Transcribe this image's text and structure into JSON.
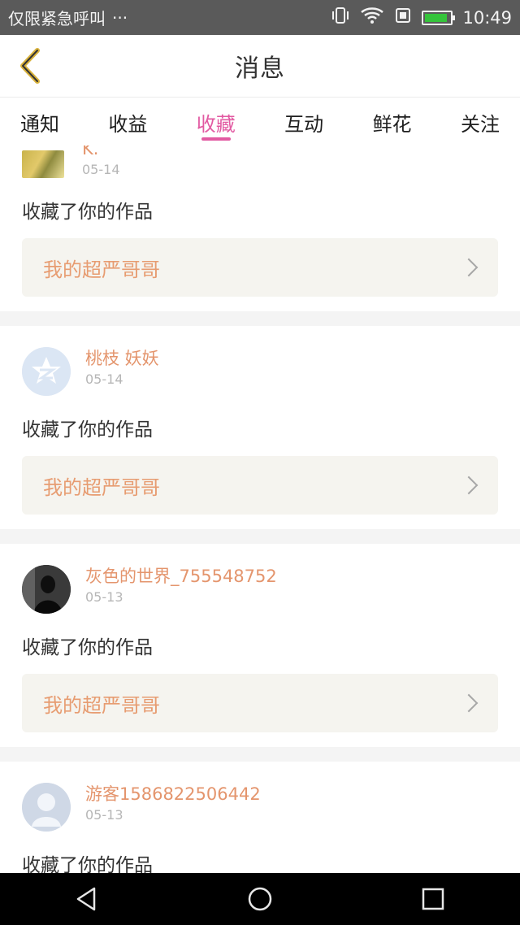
{
  "status_bar": {
    "left_text": "仅限紧急呼叫",
    "dots": "···",
    "time": "10:49",
    "icons": [
      "vibrate-icon",
      "wifi-icon",
      "sim-icon",
      "battery-icon"
    ]
  },
  "header": {
    "title": "消息",
    "back_icon": "chevron-left-icon"
  },
  "tabs": [
    "通知",
    "收益",
    "收藏",
    "互动",
    "鲜花",
    "关注"
  ],
  "active_tab": "收藏",
  "colors": {
    "accent_pink": "#e25aa2",
    "name_orange": "#e4956d",
    "work_bg": "#f5f4ef"
  },
  "feed": [
    {
      "name": "K.",
      "date": "05-14",
      "action": "收藏了你的作品",
      "work": "我的超严哥哥",
      "avatar": "photo-avatar"
    },
    {
      "name": "桃枝 妖妖",
      "date": "05-14",
      "action": "收藏了你的作品",
      "work": "我的超严哥哥",
      "avatar": "qzone-avatar"
    },
    {
      "name": "灰色的世界_755548752",
      "date": "05-13",
      "action": "收藏了你的作品",
      "work": "我的超严哥哥",
      "avatar": "dark-avatar"
    },
    {
      "name": "游客1586822506442",
      "date": "05-13",
      "action": "收藏了你的作品",
      "avatar": "default-person-avatar"
    }
  ],
  "nav": [
    "back-triangle-icon",
    "home-circle-icon",
    "recents-square-icon"
  ]
}
